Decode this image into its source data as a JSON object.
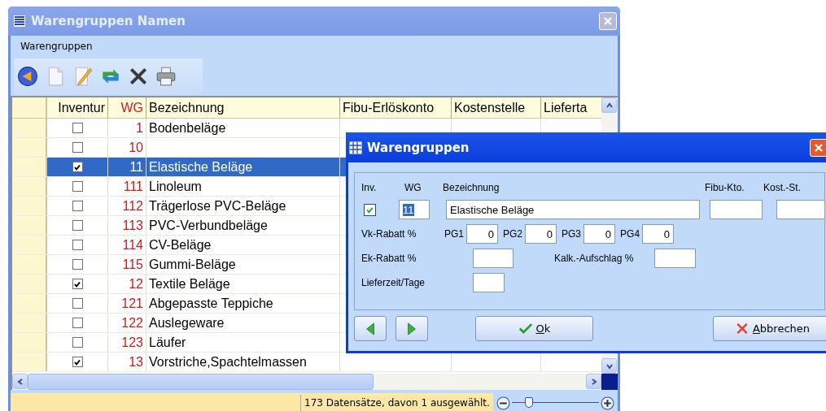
{
  "window": {
    "title": "Warengruppen Namen"
  },
  "menu": [
    {
      "label": "Warengruppen"
    }
  ],
  "table": {
    "columns": [
      {
        "label": "Inventur",
        "kind": "check"
      },
      {
        "label": "WG",
        "kind": "key"
      },
      {
        "label": "Bezeichnung",
        "kind": "text"
      },
      {
        "label": "Fibu-Erlöskonto",
        "kind": "text"
      },
      {
        "label": "Kostenstelle",
        "kind": "text"
      },
      {
        "label": "Lieferta",
        "kind": "text"
      }
    ],
    "rows": [
      {
        "inventur": false,
        "wg": "1",
        "bezeichnung": "Bodenbeläge",
        "selected": false
      },
      {
        "inventur": false,
        "wg": "10",
        "bezeichnung": "",
        "selected": false
      },
      {
        "inventur": true,
        "wg": "11",
        "bezeichnung": "Elastische Beläge",
        "selected": true
      },
      {
        "inventur": false,
        "wg": "111",
        "bezeichnung": "Linoleum",
        "selected": false
      },
      {
        "inventur": false,
        "wg": "112",
        "bezeichnung": "Trägerlose PVC-Beläge",
        "selected": false
      },
      {
        "inventur": false,
        "wg": "113",
        "bezeichnung": "PVC-Verbundbeläge",
        "selected": false
      },
      {
        "inventur": false,
        "wg": "114",
        "bezeichnung": "CV-Beläge",
        "selected": false
      },
      {
        "inventur": false,
        "wg": "115",
        "bezeichnung": "Gummi-Beläge",
        "selected": false
      },
      {
        "inventur": true,
        "wg": "12",
        "bezeichnung": "Textile Beläge",
        "selected": false
      },
      {
        "inventur": false,
        "wg": "121",
        "bezeichnung": "Abgepasste Teppiche",
        "selected": false
      },
      {
        "inventur": false,
        "wg": "122",
        "bezeichnung": "Auslegeware",
        "selected": false
      },
      {
        "inventur": false,
        "wg": "123",
        "bezeichnung": "Läufer",
        "selected": false
      },
      {
        "inventur": true,
        "wg": "13",
        "bezeichnung": "Vorstriche,Spachtelmassen",
        "selected": false
      }
    ]
  },
  "status_bar": {
    "text": "173 Datensätze, davon 1 ausgewählt.",
    "zoom": {
      "level": 0.2
    }
  },
  "dialog": {
    "title": "Warengruppen",
    "labels": {
      "inv": "Inv.",
      "wg": "WG",
      "bezeichnung": "Bezeichnung",
      "fibu": "Fibu-Kto.",
      "kost": "Kost.-St.",
      "vk": "Vk-Rabatt %",
      "ek": "Ek-Rabatt %",
      "kalk": "Kalk.-Aufschlag %",
      "lieferzeit": "Lieferzeit/Tage"
    },
    "inv_checked": true,
    "wg": "11",
    "bezeichnung": "Elastische Beläge",
    "pg": [
      {
        "label": "PG1",
        "value": "0"
      },
      {
        "label": "PG2",
        "value": "0"
      },
      {
        "label": "PG3",
        "value": "0"
      },
      {
        "label": "PG4",
        "value": "0"
      }
    ],
    "ok": "Ok",
    "cancel": "Abbrechen"
  }
}
